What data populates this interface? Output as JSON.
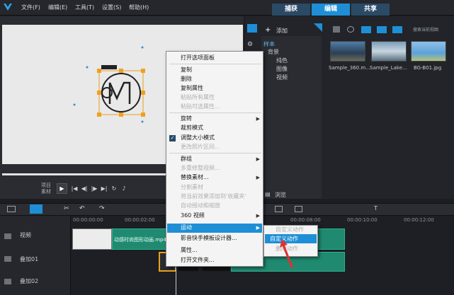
{
  "menubar": {
    "file": "文件(F)",
    "edit": "编辑(E)",
    "tools": "工具(T)",
    "settings": "设置(S)",
    "help": "帮助(H)"
  },
  "tabs": [
    {
      "label": "捕获"
    },
    {
      "label": "编辑"
    },
    {
      "label": "共享"
    }
  ],
  "preview": {
    "project_label": "项目",
    "clip_label": "素材"
  },
  "library": {
    "add_label": "添加",
    "search_placeholder": "搜索当前视图",
    "tree": {
      "sample": "样本",
      "background": "背景",
      "color": "纯色",
      "image": "图像",
      "video": "视频"
    },
    "browse_label": "浏览",
    "thumbs": [
      {
        "label": "Sample_360.m..."
      },
      {
        "label": "Sample_Lake..."
      },
      {
        "label": "BG-B01.jpg"
      }
    ]
  },
  "timeline": {
    "tracks": {
      "video": "视频",
      "overlay1": "叠加01",
      "overlay2": "叠加02"
    },
    "ruler": {
      "r0": "00:00:00:00",
      "r1": "00:00:02:00",
      "r2": "00:00:08:00",
      "r3": "00:00:10:00",
      "r4": "00:00:12:00"
    },
    "clip_title": "动感时尚图形动画.mp4"
  },
  "context_menu": {
    "open_options": "打开选项面板",
    "copy": "复制",
    "delete": "删除",
    "copy_attributes": "复制属性",
    "paste_all_attributes": "粘贴所有属性",
    "paste_selected_attributes": "粘贴可选属性...",
    "rotate": "旋转",
    "crop_mode": "裁剪模式",
    "resize_mode": "调整大小模式",
    "change_photo_interval": "更改照片区间...",
    "group": "群组",
    "multi_camera": "多重修整视频...",
    "replace_clip": "替换素材...",
    "split_clip": "分割素材",
    "add_effect_to_favorites": "将当前效果添加到'收藏夹'",
    "auto_pan_zoom": "自动摇动和缩放",
    "video_360": "360 视频",
    "motion": "运动",
    "template_designer": "影音快手模板设计器...",
    "properties": "属性...",
    "open_folder": "打开文件夹..."
  },
  "submenu": {
    "path_motion": "自定义动作",
    "custom_motion": "自定义动作",
    "delete_motion": "删除动作"
  }
}
